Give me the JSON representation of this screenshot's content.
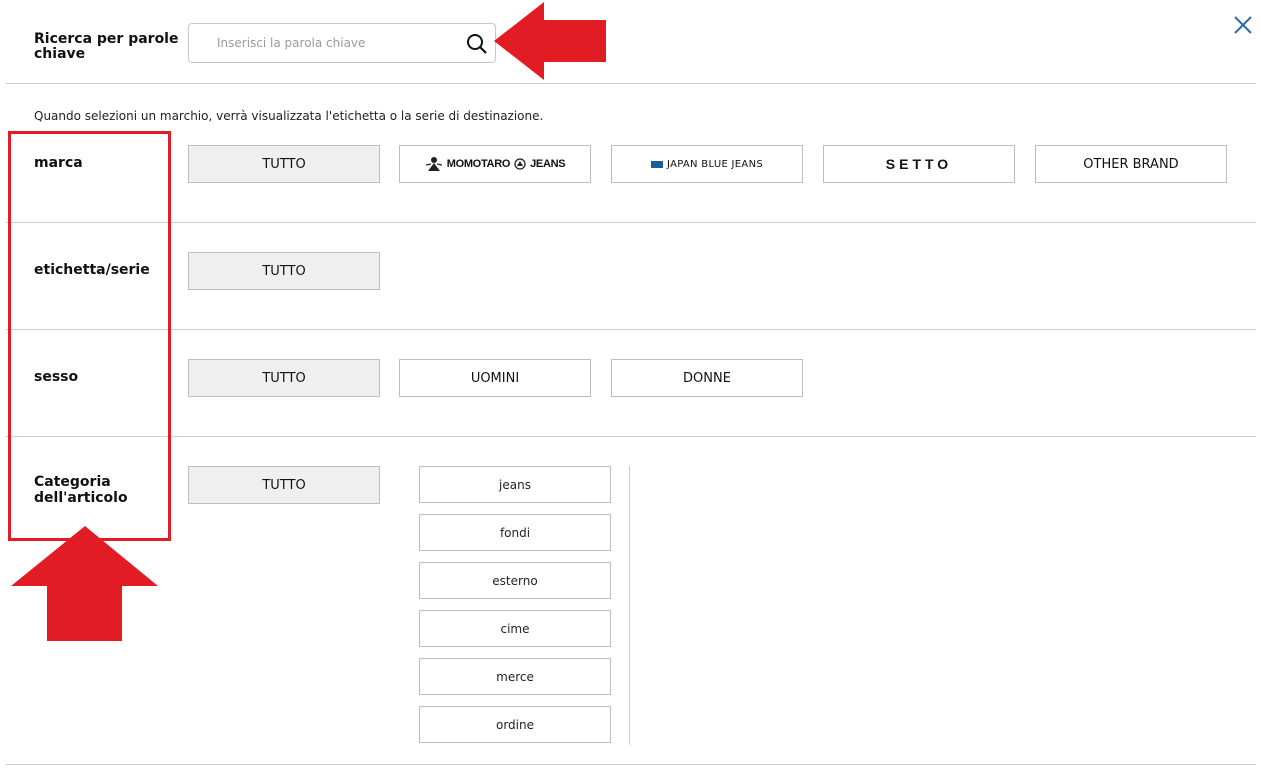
{
  "search": {
    "label": "Ricerca per parole chiave",
    "placeholder": "Inserisci la parola chiave",
    "value": ""
  },
  "note": "Quando selezioni un marchio, verrà visualizzata l'etichetta o la serie di destinazione.",
  "brand": {
    "label": "marca",
    "options": [
      "TUTTO",
      "MOMOTARO",
      "JEANS",
      "JAPAN BLUE JEANS",
      "SETTO",
      "OTHER BRAND"
    ]
  },
  "label_series": {
    "label": "etichetta/serie",
    "options": [
      "TUTTO"
    ]
  },
  "gender": {
    "label": "sesso",
    "options": [
      "TUTTO",
      "UOMINI",
      "DONNE"
    ]
  },
  "category": {
    "label": "Categoria dell'articolo",
    "all": "TUTTO",
    "items": [
      "jeans",
      "fondi",
      "esterno",
      "cime",
      "merce",
      "ordine"
    ]
  },
  "colors": {
    "annotation": "#e21c25",
    "selected_bg": "#efefef",
    "close_icon": "#2e6aa8"
  },
  "icons": {
    "close": "close-icon",
    "search": "search-icon"
  }
}
